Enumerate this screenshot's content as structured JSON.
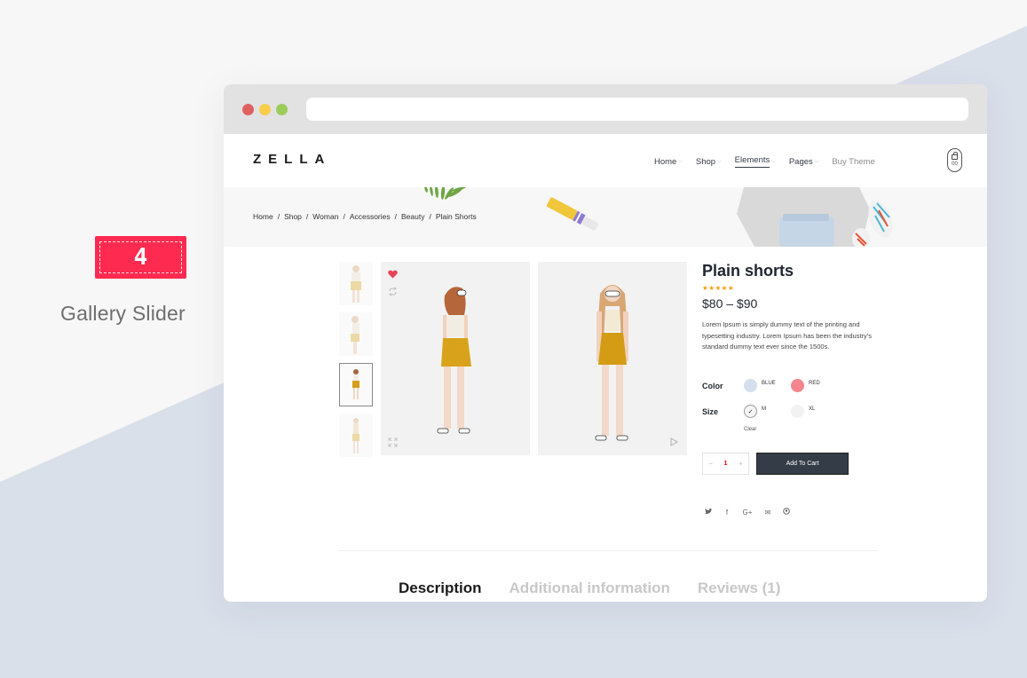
{
  "feature": {
    "badge_number": "4",
    "title": "Gallery Slider"
  },
  "colors": {
    "accent": "#fe2a4f",
    "bg_light": "#f7f7f7",
    "bg_blue": "#dae0ea",
    "button_dark": "#333c47",
    "star": "#f59e0b"
  },
  "site": {
    "logo": "ZELLA",
    "nav": [
      {
        "label": "Home",
        "has_dropdown": true
      },
      {
        "label": "Shop",
        "has_dropdown": true
      },
      {
        "label": "Elements",
        "has_dropdown": true,
        "active": true
      },
      {
        "label": "Pages",
        "has_dropdown": true
      },
      {
        "label": "Buy Theme",
        "has_dropdown": false
      }
    ],
    "cart": {
      "icon": "shopping-bag-icon",
      "count": "00"
    }
  },
  "breadcrumb": [
    "Home",
    "Shop",
    "Woman",
    "Accessories",
    "Beauty",
    "Plain Shorts"
  ],
  "breadcrumb_sep": "/",
  "product": {
    "title": "Plain shorts",
    "rating": 5,
    "rating_max": 5,
    "stars": "★★★★★",
    "price": "$80 – $90",
    "description": "Lorem Ipsum is simply dummy text of the printing and typesetting industry. Lorem Ipsum has been the industry's standard dummy text ever since the 1500s.",
    "color_label": "Color",
    "colors": [
      {
        "name": "BLUE",
        "hex": "#d5deec"
      },
      {
        "name": "RED",
        "hex": "#f4858d"
      }
    ],
    "size_label": "Size",
    "sizes": [
      {
        "name": "M",
        "selected": true
      },
      {
        "name": "XL",
        "selected": false
      }
    ],
    "clear_label": "Clear",
    "quantity": "1",
    "minus": "−",
    "plus": "+",
    "add_to_cart": "Add To Cart",
    "social": [
      {
        "icon": "twitter-icon",
        "glyph": "🐦"
      },
      {
        "icon": "facebook-icon",
        "glyph": "f"
      },
      {
        "icon": "google-plus-icon",
        "glyph": "G+"
      },
      {
        "icon": "email-icon",
        "glyph": "✉"
      },
      {
        "icon": "pinterest-icon",
        "glyph": "℗"
      }
    ],
    "gallery": {
      "thumbnails": 4,
      "selected_thumbnail": 3,
      "slides": 2
    }
  },
  "tabs": [
    {
      "label": "Description",
      "active": true
    },
    {
      "label": "Additional information",
      "active": false
    },
    {
      "label": "Reviews (1)",
      "active": false
    }
  ]
}
